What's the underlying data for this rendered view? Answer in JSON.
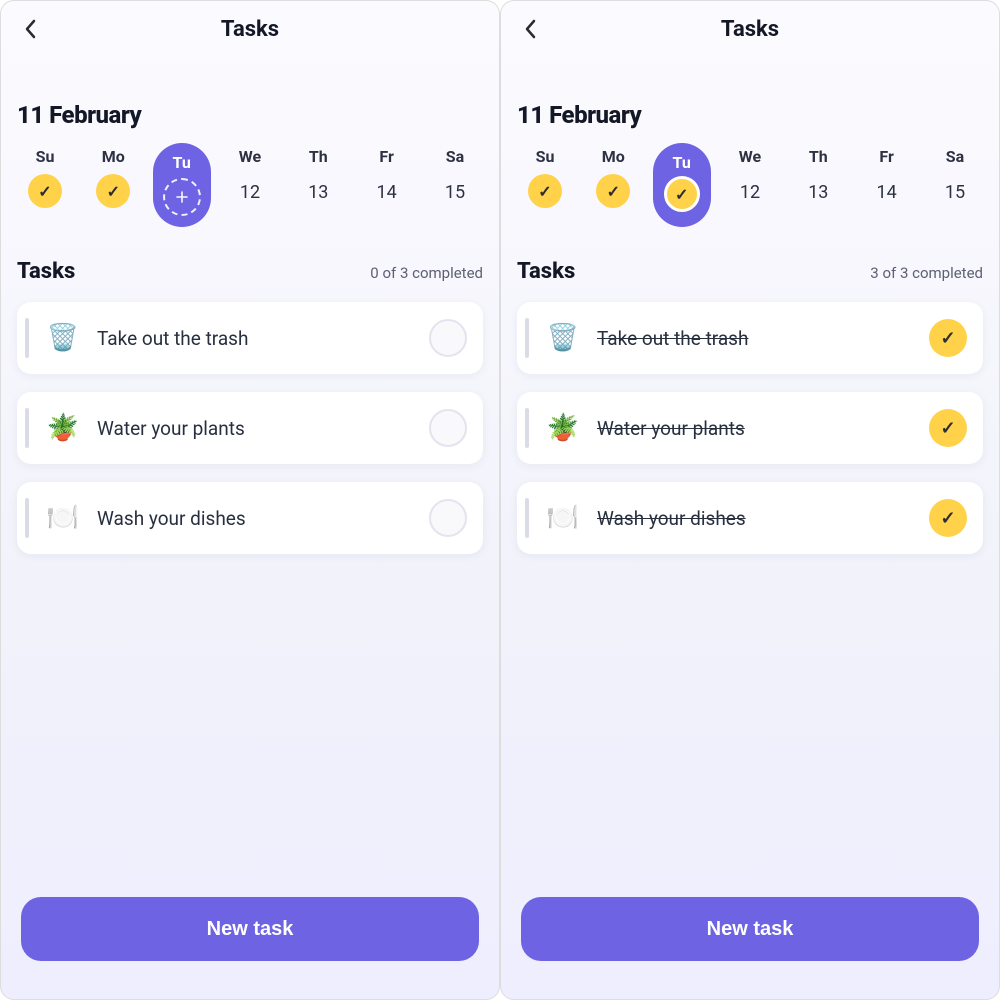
{
  "left": {
    "topbar": {
      "title": "Tasks"
    },
    "date_heading": "11 February",
    "week": [
      {
        "label": "Su",
        "state": "done"
      },
      {
        "label": "Mo",
        "state": "done"
      },
      {
        "label": "Tu",
        "state": "selected-pending"
      },
      {
        "label": "We",
        "num": "12"
      },
      {
        "label": "Th",
        "num": "13"
      },
      {
        "label": "Fr",
        "num": "14"
      },
      {
        "label": "Sa",
        "num": "15"
      }
    ],
    "section": {
      "title": "Tasks",
      "sub": "0 of 3 completed"
    },
    "tasks": [
      {
        "emoji": "🗑️",
        "label": "Take out the trash",
        "done": false
      },
      {
        "emoji": "🪴",
        "label": "Water your plants",
        "done": false
      },
      {
        "emoji": "🍽️",
        "label": "Wash your dishes",
        "done": false
      }
    ],
    "cta": "New task"
  },
  "right": {
    "topbar": {
      "title": "Tasks"
    },
    "date_heading": "11 February",
    "week": [
      {
        "label": "Su",
        "state": "done"
      },
      {
        "label": "Mo",
        "state": "done"
      },
      {
        "label": "Tu",
        "state": "selected-done"
      },
      {
        "label": "We",
        "num": "12"
      },
      {
        "label": "Th",
        "num": "13"
      },
      {
        "label": "Fr",
        "num": "14"
      },
      {
        "label": "Sa",
        "num": "15"
      }
    ],
    "section": {
      "title": "Tasks",
      "sub": "3 of 3 completed"
    },
    "tasks": [
      {
        "emoji": "🗑️",
        "label": "Take out the trash",
        "done": true
      },
      {
        "emoji": "🪴",
        "label": "Water your plants",
        "done": true
      },
      {
        "emoji": "🍽️",
        "label": "Wash your dishes",
        "done": true
      }
    ],
    "cta": "New task"
  }
}
